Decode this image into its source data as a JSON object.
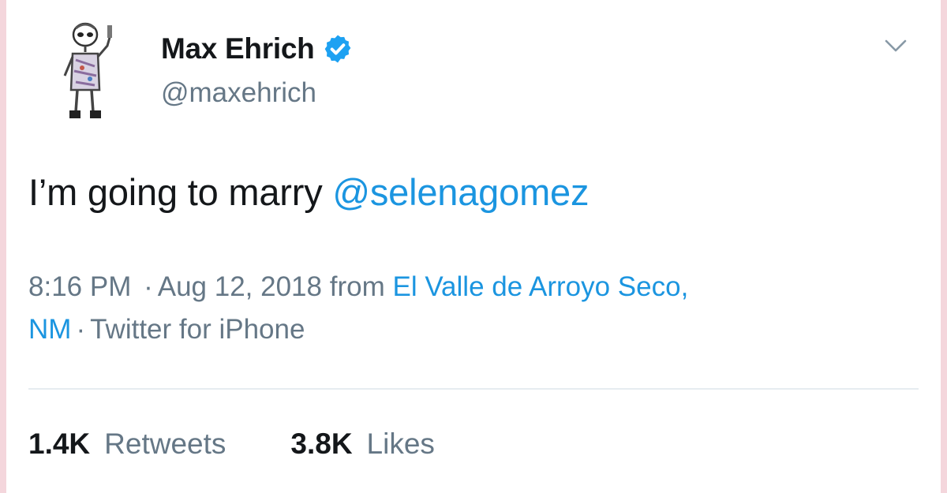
{
  "tweet": {
    "display_name": "Max Ehrich",
    "handle": "@maxehrich",
    "verified": true,
    "text_prefix": "I’m going to marry ",
    "mention": "@selenagomez",
    "time": "8:16 PM",
    "date": "Aug 12, 2018",
    "from_label": "from",
    "location_line1": "El Valle de Arroyo Seco,",
    "location_line2": "NM",
    "separator": "·",
    "source": "Twitter for iPhone"
  },
  "stats": {
    "retweets_count": "1.4K",
    "retweets_label": "Retweets",
    "likes_count": "3.8K",
    "likes_label": "Likes"
  },
  "icons": {
    "verified": "verified-badge-icon",
    "menu": "chevron-down-icon",
    "avatar": "alien-sketch-avatar"
  },
  "colors": {
    "link": "#1b95e0",
    "secondary_text": "#657786",
    "primary_text": "#14171a",
    "verified_badge": "#1da1f2",
    "page_edge": "#f4d6dc"
  }
}
